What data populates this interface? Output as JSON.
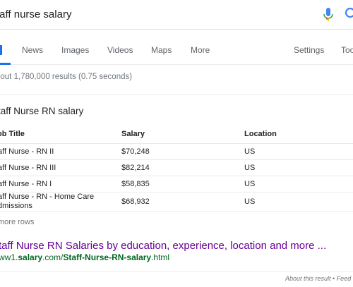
{
  "search": {
    "query": "taff nurse salary"
  },
  "tabs": [
    {
      "label": "l",
      "active": true
    },
    {
      "label": "News"
    },
    {
      "label": "Images"
    },
    {
      "label": "Videos"
    },
    {
      "label": "Maps"
    },
    {
      "label": "More"
    },
    {
      "label": "Settings"
    },
    {
      "label": "Too"
    }
  ],
  "result_stats": "bout 1,780,000 results (0.75 seconds)",
  "card": {
    "title": "taff Nurse RN salary",
    "columns": [
      "ob Title",
      "Salary",
      "Location"
    ],
    "rows": [
      {
        "title": "aff Nurse - RN II",
        "salary": "$70,248",
        "location": "US"
      },
      {
        "title": "aff Nurse - RN III",
        "salary": "$82,214",
        "location": "US"
      },
      {
        "title": "aff Nurse - RN I",
        "salary": "$58,835",
        "location": "US"
      },
      {
        "title_line1": "aff Nurse - RN - Home Care",
        "title_line2": "dmissions",
        "salary": "$68,932",
        "location": "US"
      }
    ],
    "more_rows": "more rows"
  },
  "result": {
    "link_text": "taff Nurse RN Salaries by education, experience, location and more ...",
    "url_prefix": "ww1.",
    "url_bold1": "salary",
    "url_mid": ".com/",
    "url_bold2": "Staff-Nurse-RN-salary",
    "url_suffix": ".html"
  },
  "footer": "About this result • Feed",
  "colors": {
    "link": "#660099",
    "url": "#006621",
    "accent": "#1a73e8"
  }
}
